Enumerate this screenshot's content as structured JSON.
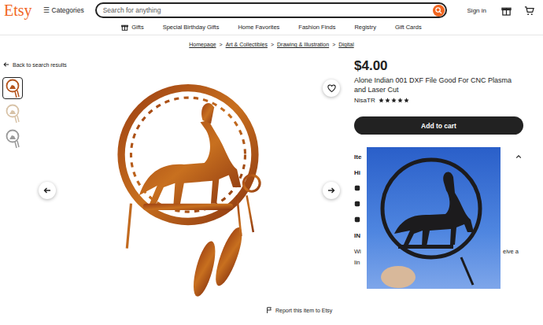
{
  "header": {
    "logo": "Etsy",
    "categories_icon": "☰",
    "categories": "Categories",
    "search_placeholder": "Search for anything",
    "sign_in": "Sign in"
  },
  "nav": [
    {
      "label": "Gifts",
      "kind": "icon-link"
    },
    {
      "label": "Special Birthday Gifts",
      "kind": "link"
    },
    {
      "label": "Home Favorites",
      "kind": "link"
    },
    {
      "label": "Fashion Finds",
      "kind": "link"
    },
    {
      "label": "Registry",
      "kind": "link"
    },
    {
      "label": "Gift Cards",
      "kind": "link"
    }
  ],
  "breadcrumb": [
    "Homepage",
    "Art & Collectibles",
    "Drawing & Illustration",
    "Digital"
  ],
  "breadcrumb_separator": ">",
  "back_link": "Back to search results",
  "thumbnails": [
    {
      "selected": true,
      "color": "#b5541c"
    },
    {
      "selected": false,
      "color": "#d8c3a8"
    },
    {
      "selected": false,
      "color": "#9a9a9a"
    }
  ],
  "listing": {
    "price": "$4.00",
    "title": "Alone Indian 001 DXF File Good For CNC Plasma and Laser Cut",
    "shop": "NisaTR",
    "stars": 5,
    "add_to_cart": "Add to cart"
  },
  "details": {
    "expanded": true,
    "items": [
      {
        "kind": "heading",
        "text": "Ite"
      },
      {
        "kind": "heading",
        "text": "Hi"
      },
      {
        "kind": "icon",
        "text": ""
      },
      {
        "kind": "icon",
        "text": ""
      },
      {
        "kind": "icon",
        "text": ""
      },
      {
        "kind": "heading",
        "text": "IN"
      },
      {
        "kind": "text",
        "text": "Wi"
      },
      {
        "kind": "text",
        "text": "lin"
      }
    ],
    "right_text": "eive a"
  },
  "report": "Report this item to Etsy"
}
